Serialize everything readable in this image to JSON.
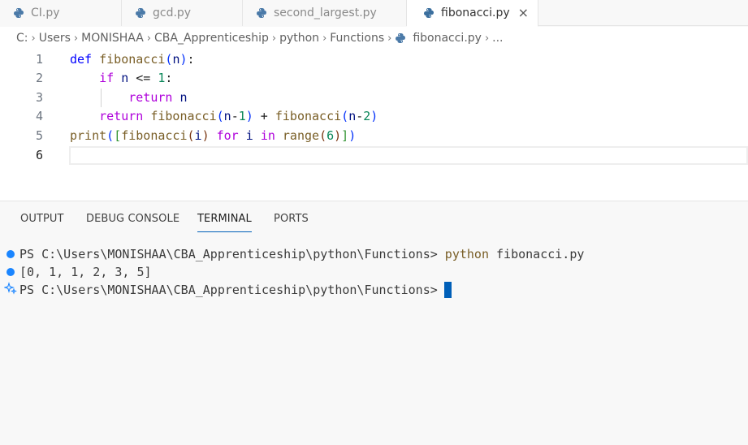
{
  "tabs": [
    {
      "label": "CI.py",
      "active": false
    },
    {
      "label": "gcd.py",
      "active": false
    },
    {
      "label": "second_largest.py",
      "active": false
    },
    {
      "label": "fibonacci.py",
      "active": true
    }
  ],
  "close_icon": "×",
  "breadcrumb": {
    "items": [
      "C:",
      "Users",
      "MONISHAA",
      "CBA_Apprenticeship",
      "python",
      "Functions",
      "fibonacci.py",
      "..."
    ],
    "separator": "›"
  },
  "editor": {
    "line_numbers": [
      "1",
      "2",
      "3",
      "4",
      "5",
      "6"
    ],
    "lines": [
      "def fibonacci(n):",
      "    if n <= 1:",
      "        return n",
      "    return fibonacci(n-1) + fibonacci(n-2)",
      "print([fibonacci(i) for i in range(6)])",
      ""
    ]
  },
  "panel": {
    "tabs": [
      "OUTPUT",
      "DEBUG CONSOLE",
      "TERMINAL",
      "PORTS"
    ],
    "active_tab": "TERMINAL"
  },
  "terminal": {
    "prompt1": "PS C:\\Users\\MONISHAA\\CBA_Apprenticeship\\python\\Functions> ",
    "cmd_program": "python",
    "cmd_args": " fibonacci.py",
    "output": "[0, 1, 1, 2, 3, 5]",
    "prompt2": "PS C:\\Users\\MONISHAA\\CBA_Apprenticeship\\python\\Functions>"
  },
  "colors": {
    "accent": "#005fb8",
    "status_dot": "#1a85ff",
    "keyword": "#0000ff",
    "function": "#795e26"
  }
}
